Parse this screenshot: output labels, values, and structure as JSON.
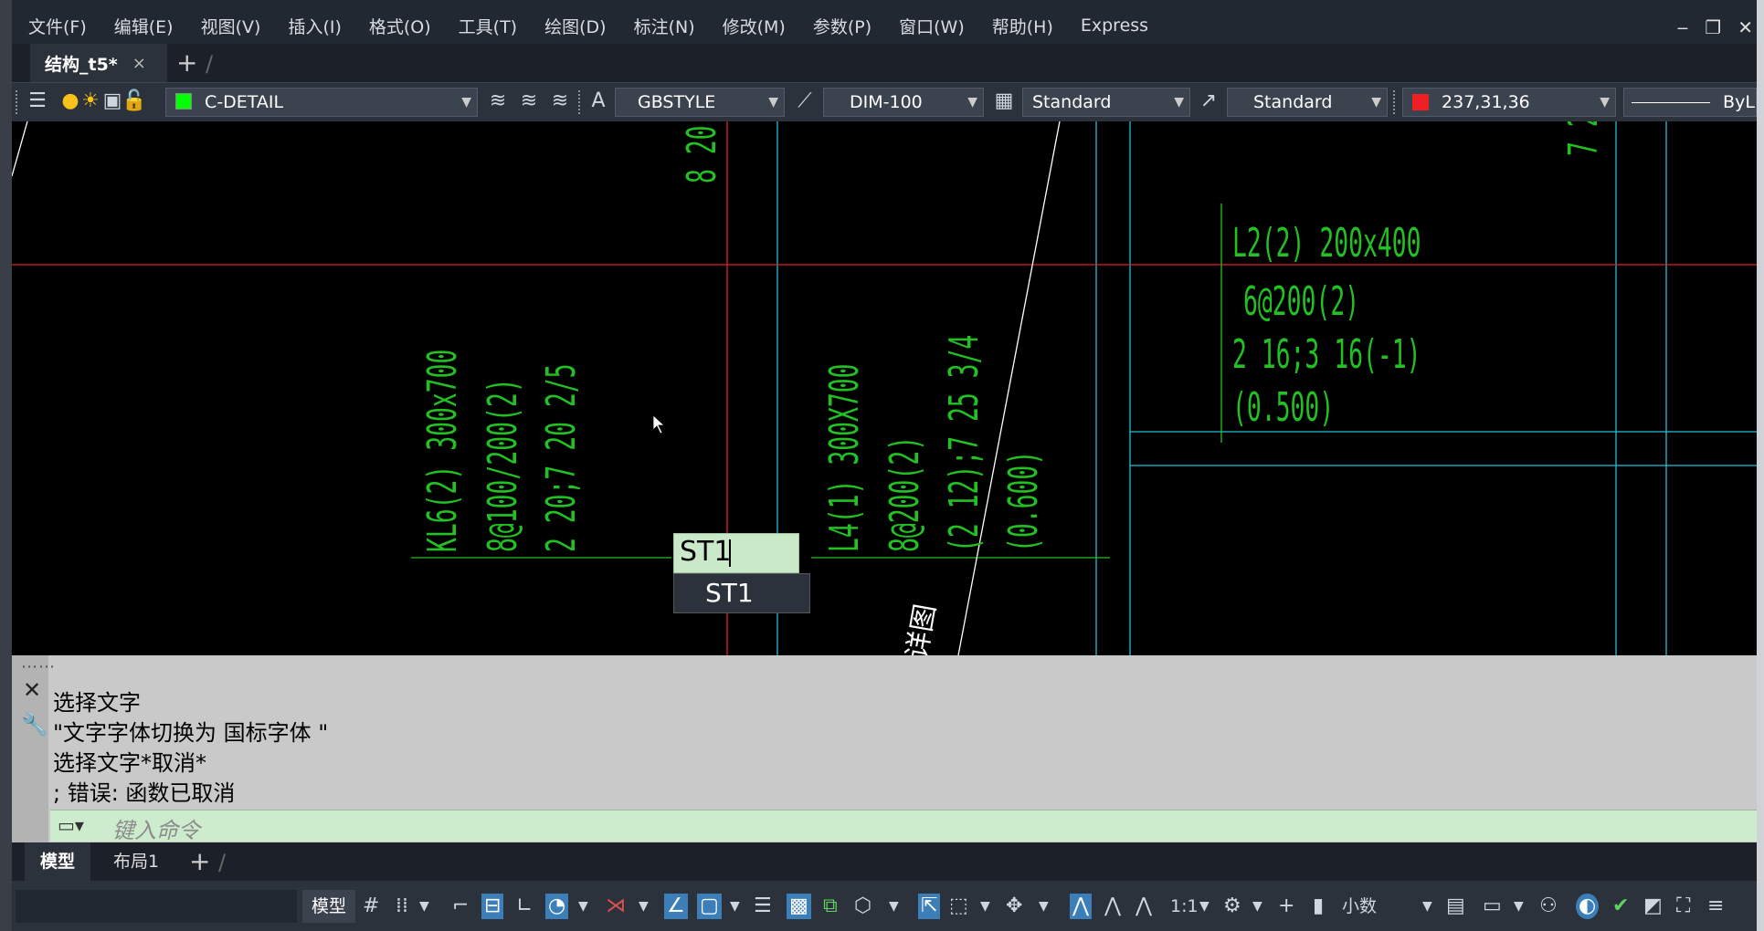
{
  "menu": [
    "文件(F)",
    "编辑(E)",
    "视图(V)",
    "插入(I)",
    "格式(O)",
    "工具(T)",
    "绘图(D)",
    "标注(N)",
    "修改(M)",
    "参数(P)",
    "窗口(W)",
    "帮助(H)",
    "Express"
  ],
  "document_tab": {
    "label": "结构_t5*",
    "close": "×",
    "add": "+"
  },
  "toolbar": {
    "layer": "C-DETAIL",
    "layer_color": "#00ff00",
    "text_style": "GBSTYLE",
    "dim_style": "DIM-100",
    "table_style": "Standard",
    "mleader_style": "Standard",
    "color": "237,31,36",
    "color_swatch": "#ed1f24",
    "linetype": "ByLaye"
  },
  "drawing": {
    "texts": {
      "top1": "8 20",
      "top2": "7 2",
      "kl6_1": "KL6(2) 300x700",
      "kl6_2": "8@100/200(2)",
      "kl6_3": "2 20;7 20 2/5",
      "l4_1": "L4(1) 300X700",
      "l4_2": "8@200(2)",
      "l4_3": "(2 12);7 25 3/4",
      "l4_4": "(0.600)",
      "l2_1": "L2(2) 200x400",
      "l2_2": "6@200(2)",
      "l2_3": "2 16;3 16(-1)",
      "l2_4": "(0.500)",
      "detail": "详图"
    },
    "inline_edit": "ST1",
    "autocomplete": "ST1"
  },
  "command": {
    "history": [
      "选择文字",
      "\"文字字体切换为 国标字体 \"",
      "选择文字*取消*",
      "; 错误: 函数已取消"
    ],
    "placeholder": "键入命令"
  },
  "layouts": {
    "model": "模型",
    "layout1": "布局1",
    "add": "+"
  },
  "status": {
    "model": "模型",
    "scale": "1:1",
    "units": "小数"
  }
}
